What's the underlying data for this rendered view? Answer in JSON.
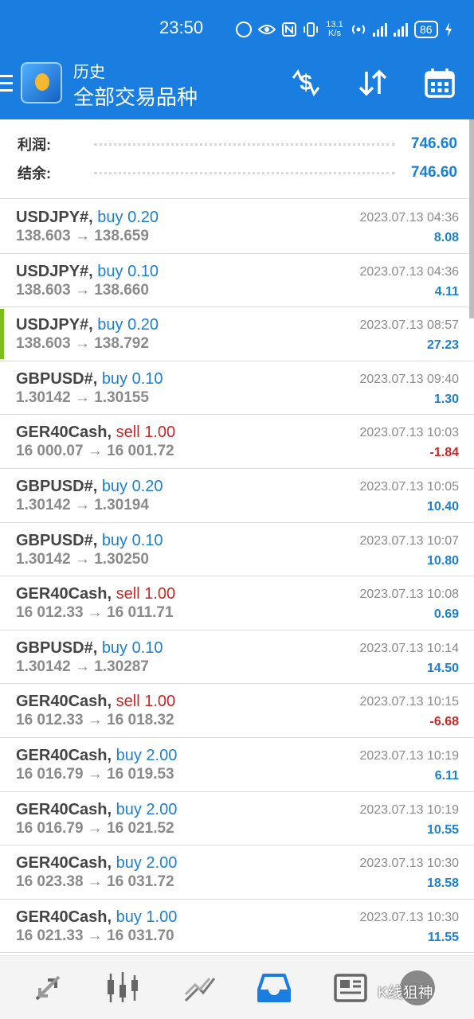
{
  "status_bar": {
    "time": "23:50",
    "speed_value": "13.1",
    "speed_unit": "K/s",
    "battery": "86"
  },
  "header": {
    "subtitle": "历史",
    "title": "全部交易品种",
    "actions": [
      "currency-exchange-icon",
      "sort-icon",
      "calendar-icon"
    ]
  },
  "summary": {
    "profit_label": "利润:",
    "profit_value": "746.60",
    "balance_label": "结余:",
    "balance_value": "746.60"
  },
  "colors": {
    "accent": "#1a7de0",
    "buy": "#1d7fd1",
    "sell": "#c62828",
    "active_marker": "#7cbd1e"
  },
  "deals": [
    {
      "symbol": "USDJPY#,",
      "side": "buy 0.20",
      "side_type": "buy",
      "prices": "138.603 → 138.659",
      "time": "2023.07.13 04:36",
      "profit": "8.08",
      "profit_sign": "pos"
    },
    {
      "symbol": "USDJPY#,",
      "side": "buy 0.10",
      "side_type": "buy",
      "prices": "138.603 → 138.660",
      "time": "2023.07.13 04:36",
      "profit": "4.11",
      "profit_sign": "pos"
    },
    {
      "symbol": "USDJPY#,",
      "side": "buy 0.20",
      "side_type": "buy",
      "prices": "138.603 → 138.792",
      "time": "2023.07.13 08:57",
      "profit": "27.23",
      "profit_sign": "pos",
      "active": true
    },
    {
      "symbol": "GBPUSD#,",
      "side": "buy 0.10",
      "side_type": "buy",
      "prices": "1.30142 → 1.30155",
      "time": "2023.07.13 09:40",
      "profit": "1.30",
      "profit_sign": "pos"
    },
    {
      "symbol": "GER40Cash,",
      "side": "sell 1.00",
      "side_type": "sell",
      "prices": "16 000.07 → 16 001.72",
      "time": "2023.07.13 10:03",
      "profit": "-1.84",
      "profit_sign": "neg"
    },
    {
      "symbol": "GBPUSD#,",
      "side": "buy 0.20",
      "side_type": "buy",
      "prices": "1.30142 → 1.30194",
      "time": "2023.07.13 10:05",
      "profit": "10.40",
      "profit_sign": "pos"
    },
    {
      "symbol": "GBPUSD#,",
      "side": "buy 0.10",
      "side_type": "buy",
      "prices": "1.30142 → 1.30250",
      "time": "2023.07.13 10:07",
      "profit": "10.80",
      "profit_sign": "pos"
    },
    {
      "symbol": "GER40Cash,",
      "side": "sell 1.00",
      "side_type": "sell",
      "prices": "16 012.33 → 16 011.71",
      "time": "2023.07.13 10:08",
      "profit": "0.69",
      "profit_sign": "pos"
    },
    {
      "symbol": "GBPUSD#,",
      "side": "buy 0.10",
      "side_type": "buy",
      "prices": "1.30142 → 1.30287",
      "time": "2023.07.13 10:14",
      "profit": "14.50",
      "profit_sign": "pos"
    },
    {
      "symbol": "GER40Cash,",
      "side": "sell 1.00",
      "side_type": "sell",
      "prices": "16 012.33 → 16 018.32",
      "time": "2023.07.13 10:15",
      "profit": "-6.68",
      "profit_sign": "neg"
    },
    {
      "symbol": "GER40Cash,",
      "side": "buy 2.00",
      "side_type": "buy",
      "prices": "16 016.79 → 16 019.53",
      "time": "2023.07.13 10:19",
      "profit": "6.11",
      "profit_sign": "pos"
    },
    {
      "symbol": "GER40Cash,",
      "side": "buy 2.00",
      "side_type": "buy",
      "prices": "16 016.79 → 16 021.52",
      "time": "2023.07.13 10:19",
      "profit": "10.55",
      "profit_sign": "pos"
    },
    {
      "symbol": "GER40Cash,",
      "side": "buy 2.00",
      "side_type": "buy",
      "prices": "16 023.38 → 16 031.72",
      "time": "2023.07.13 10:30",
      "profit": "18.58",
      "profit_sign": "pos"
    },
    {
      "symbol": "GER40Cash,",
      "side": "buy 1.00",
      "side_type": "buy",
      "prices": "16 021.33 → 16 031.70",
      "time": "2023.07.13 10:30",
      "profit": "11.55",
      "profit_sign": "pos"
    }
  ],
  "bottom_nav": {
    "items": [
      "quotes-icon",
      "chart-icon",
      "trade-icon",
      "history-icon",
      "news-icon"
    ],
    "active": "history-icon"
  },
  "watermark": "K线狙神"
}
